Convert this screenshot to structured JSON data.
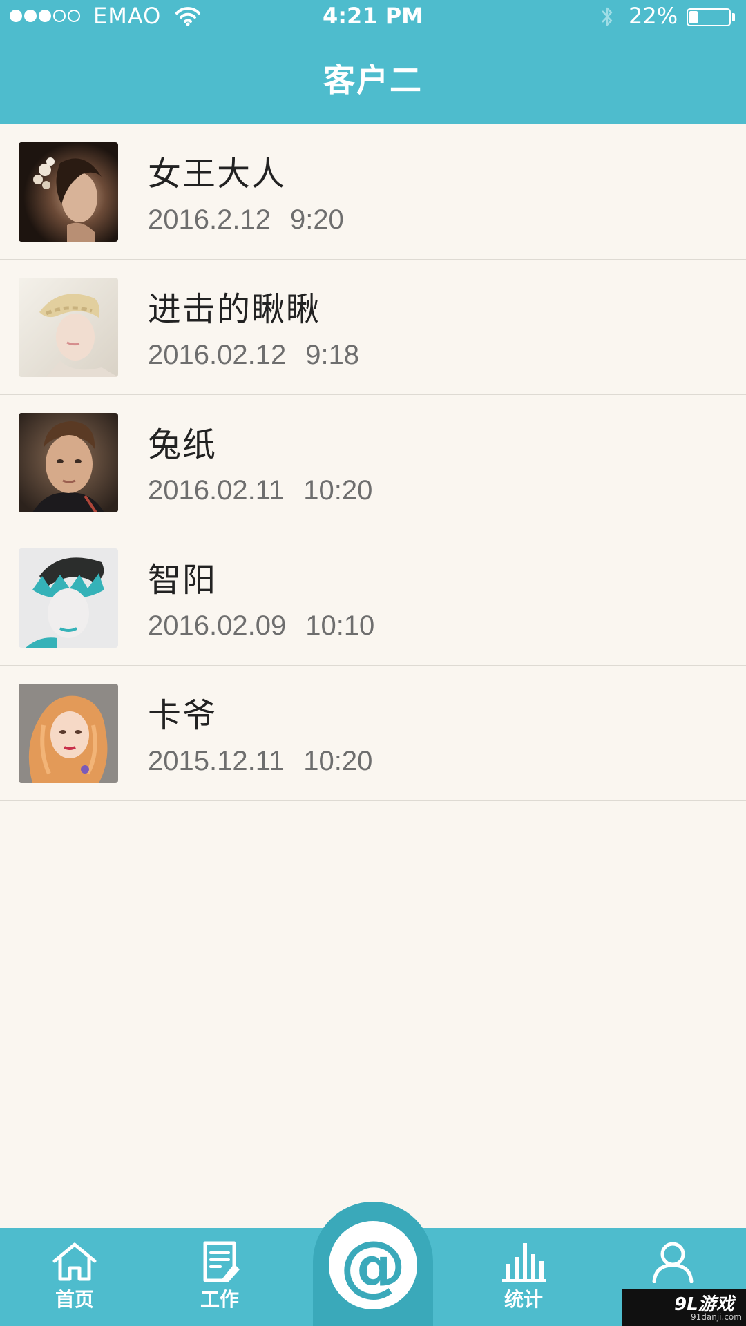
{
  "status_bar": {
    "carrier": "EMAO",
    "time": "4:21 PM",
    "battery_percent": "22%",
    "battery_level": 0.22,
    "signal_bars_filled": 3,
    "signal_bars_total": 5
  },
  "header": {
    "title": "客户二"
  },
  "colors": {
    "accent": "#4ebccd",
    "accent_dark": "#3aa9ba",
    "background": "#faf6f0",
    "name_text": "#222222",
    "date_text": "#6e6e6e"
  },
  "clients": [
    {
      "name": "女王大人",
      "date": "2016.2.12",
      "time": "9:20",
      "avatar": "woman-flower-portrait"
    },
    {
      "name": "进击的瞅瞅",
      "date": "2016.02.12",
      "time": "9:18",
      "avatar": "blonde-woman-braid-portrait"
    },
    {
      "name": "兔纸",
      "date": "2016.02.11",
      "time": "10:20",
      "avatar": "man-portrait"
    },
    {
      "name": "智阳",
      "date": "2016.02.09",
      "time": "10:10",
      "avatar": "anime-man-headband-portrait"
    },
    {
      "name": "卡爷",
      "date": "2015.12.11",
      "time": "10:20",
      "avatar": "redhead-woman-portrait"
    }
  ],
  "tabbar": {
    "home": {
      "label": "首页",
      "icon": "home-icon"
    },
    "work": {
      "label": "工作",
      "icon": "document-edit-icon"
    },
    "center": {
      "symbol": "@",
      "icon": "at-icon"
    },
    "stats": {
      "label": "统计",
      "icon": "bar-chart-icon"
    },
    "profile": {
      "label": "",
      "icon": "user-icon"
    }
  },
  "watermark": {
    "main": "9L游戏",
    "sub": "91danji.com"
  }
}
